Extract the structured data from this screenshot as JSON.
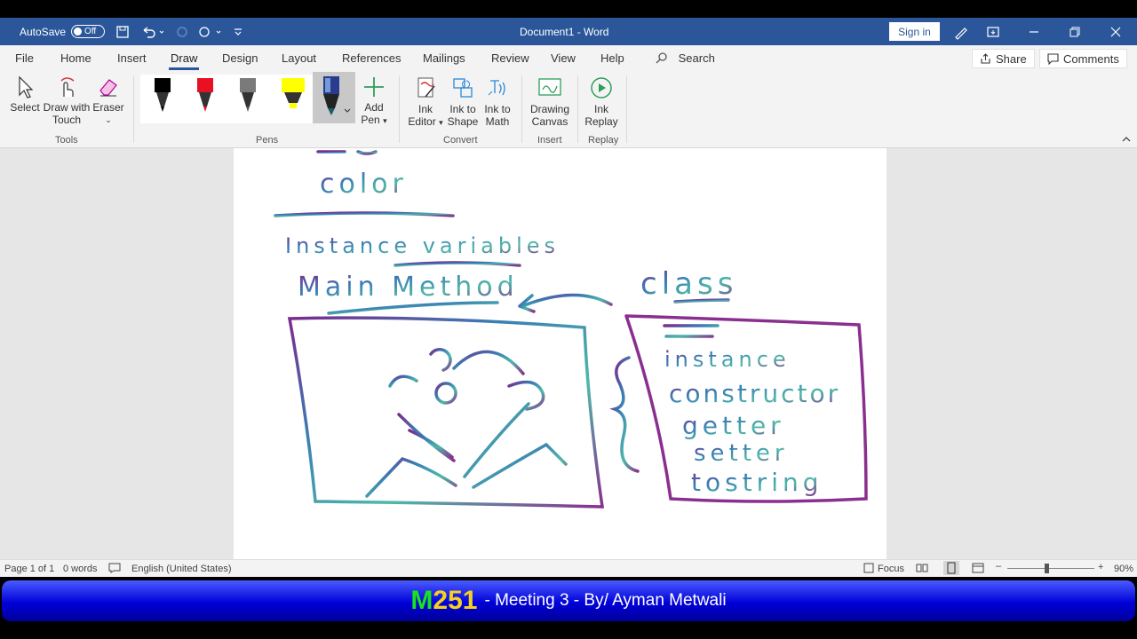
{
  "titlebar": {
    "autosave_label": "AutoSave",
    "autosave_state": "Off",
    "doc_title": "Document1  -  Word",
    "signin_label": "Sign in"
  },
  "tabs": [
    "File",
    "Home",
    "Insert",
    "Draw",
    "Design",
    "Layout",
    "References",
    "Mailings",
    "Review",
    "View",
    "Help"
  ],
  "active_tab": "Draw",
  "search_label": "Search",
  "share_label": "Share",
  "comments_label": "Comments",
  "ribbon": {
    "tools": {
      "select": "Select",
      "draw_touch_1": "Draw with",
      "draw_touch_2": "Touch",
      "eraser": "Eraser",
      "group": "Tools"
    },
    "pens": {
      "add_pen_1": "Add",
      "add_pen_2": "Pen",
      "group": "Pens"
    },
    "convert": {
      "ink_editor_1": "Ink",
      "ink_editor_2": "Editor",
      "ink_shape_1": "Ink to",
      "ink_shape_2": "Shape",
      "ink_math_1": "Ink to",
      "ink_math_2": "Math",
      "group": "Convert"
    },
    "insert": {
      "canvas_1": "Drawing",
      "canvas_2": "Canvas",
      "group": "Insert"
    },
    "replay": {
      "replay_1": "Ink",
      "replay_2": "Replay",
      "group": "Replay"
    }
  },
  "pen_colors": [
    "#000000",
    "#e81123",
    "#7a7a7a",
    "#ffff00",
    "#3a3a8a"
  ],
  "ink": {
    "color_word": "color",
    "instance_vars": "Instance variables",
    "main_method": "Main Method",
    "class_word": "class",
    "instance": "instance",
    "constructor": "constructor",
    "getter": "getter",
    "setter": "setter",
    "tostring": "tostring"
  },
  "status": {
    "page": "Page 1 of 1",
    "words": "0 words",
    "language": "English (United States)",
    "focus": "Focus",
    "zoom": "90%"
  },
  "banner": {
    "course_letter": "M",
    "course_number": "251",
    "subtitle": "- Meeting 3 - By/ Ayman Metwali"
  }
}
